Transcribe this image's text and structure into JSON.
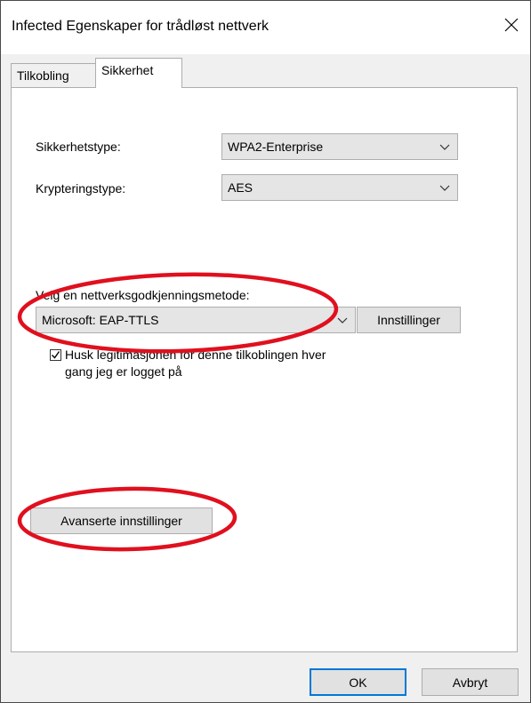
{
  "window": {
    "title": "Infected Egenskaper for trådløst nettverk",
    "close_icon": "close-icon"
  },
  "tabs": [
    {
      "label": "Tilkobling",
      "selected": false
    },
    {
      "label": "Sikkerhet",
      "selected": true
    }
  ],
  "security": {
    "security_type_label": "Sikkerhetstype:",
    "security_type_value": "WPA2-Enterprise",
    "encryption_type_label": "Krypteringstype:",
    "encryption_type_value": "AES",
    "auth_method_label": "Velg en nettverksgodkjenningsmetode:",
    "auth_method_value": "Microsoft: EAP-TTLS",
    "settings_button": "Innstillinger",
    "remember_checkbox_checked": true,
    "remember_line1": "Husk legitimasjonen for denne tilkoblingen hver",
    "remember_line2": "gang jeg er logget på",
    "advanced_button": "Avanserte innstillinger"
  },
  "footer": {
    "ok_button": "OK",
    "cancel_button": "Avbryt"
  },
  "colors": {
    "annotation": "#e0101e",
    "focus_border": "#0078d7"
  }
}
